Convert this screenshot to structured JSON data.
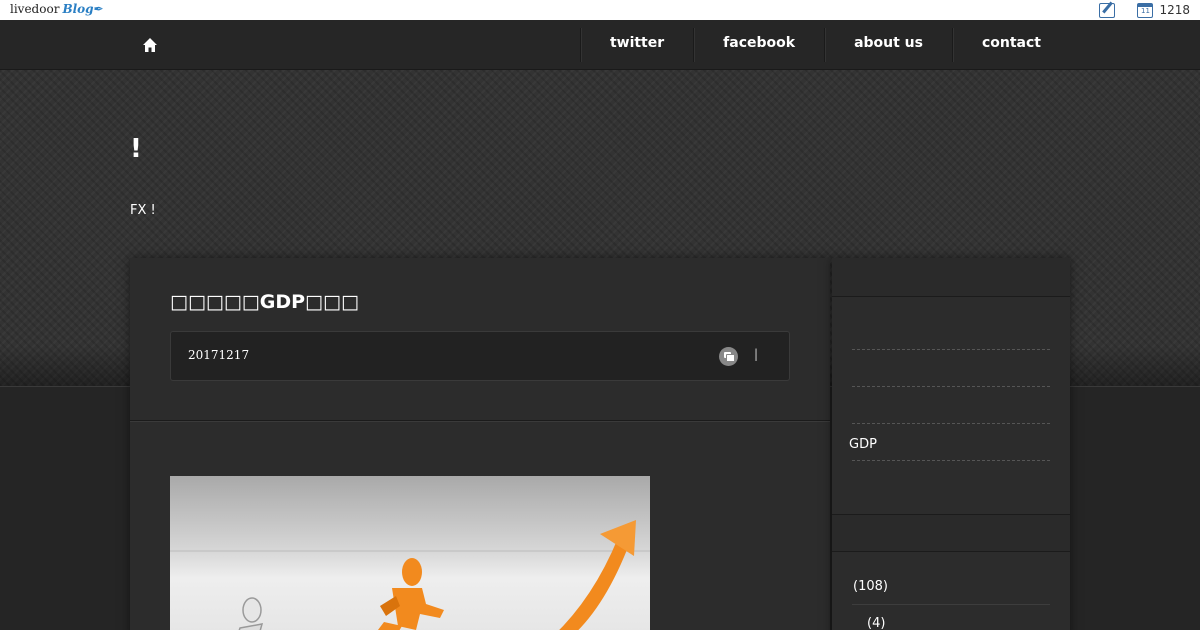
{
  "livedoor_bar": {
    "logo": "livedoor",
    "logo_blog": "Blog",
    "count": "1218",
    "calendar_day": "11"
  },
  "nav": {
    "items": [
      "twitter",
      "facebook",
      "about us",
      "contact"
    ]
  },
  "site": {
    "title": "!",
    "description": "FX !"
  },
  "article": {
    "title": "□□□□□GDP□□□",
    "date": "20171217",
    "separator": "|"
  },
  "sidebar": {
    "links": [
      "",
      "",
      "",
      "GDP"
    ],
    "archives": [
      "(108)",
      "(4)"
    ]
  },
  "colors": {
    "accent_orange": "#f28a1e",
    "header_dark": "#262626"
  }
}
